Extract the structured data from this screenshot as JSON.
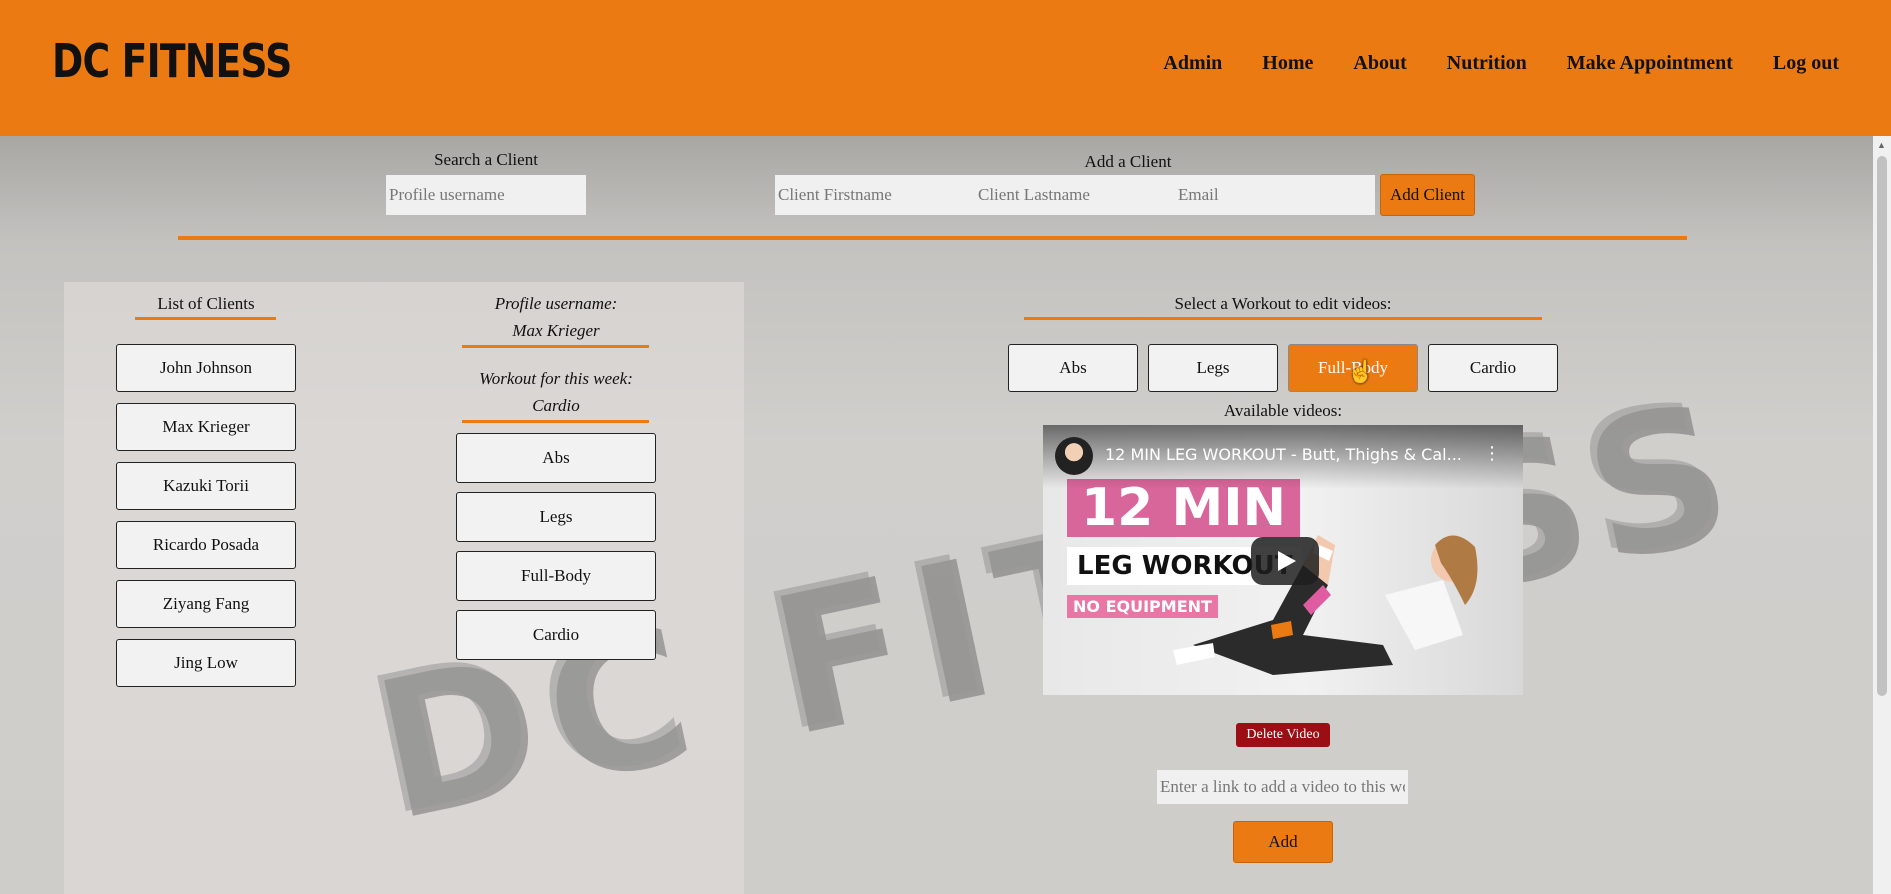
{
  "brand": {
    "logo": "DC FITNESS"
  },
  "nav": [
    "Admin",
    "Home",
    "About",
    "Nutrition",
    "Make Appointment",
    "Log out"
  ],
  "search": {
    "label": "Search a Client",
    "placeholder": "Profile username"
  },
  "add_client": {
    "label": "Add a Client",
    "firstname_placeholder": "Client Firstname",
    "lastname_placeholder": "Client Lastname",
    "email_placeholder": "Email",
    "button": "Add Client"
  },
  "clients": {
    "heading": "List of Clients",
    "items": [
      "John Johnson",
      "Max Krieger",
      "Kazuki Torii",
      "Ricardo Posada",
      "Ziyang Fang",
      "Jing Low"
    ]
  },
  "profile": {
    "username_label": "Profile username:",
    "username": "Max Krieger",
    "workout_label": "Workout for this week:",
    "workout": "Cardio",
    "options": [
      "Abs",
      "Legs",
      "Full-Body",
      "Cardio"
    ]
  },
  "editor": {
    "heading": "Select a Workout to edit videos:",
    "tabs": [
      "Abs",
      "Legs",
      "Full-Body",
      "Cardio"
    ],
    "selected_tab": "Full-Body",
    "available_label": "Available videos:",
    "video": {
      "title": "12 MIN LEG WORKOUT - Butt, Thighs & Cal...",
      "thumb_big": "12 MIN",
      "thumb_sub": "LEG WORKOUT",
      "thumb_badge": "NO EQUIPMENT"
    },
    "delete_button": "Delete Video",
    "link_placeholder": "Enter a link to add a video to this workout",
    "add_button": "Add"
  },
  "colors": {
    "accent": "#ec7a12",
    "danger": "#9b0e14",
    "button_bg": "#f2f2f2"
  }
}
